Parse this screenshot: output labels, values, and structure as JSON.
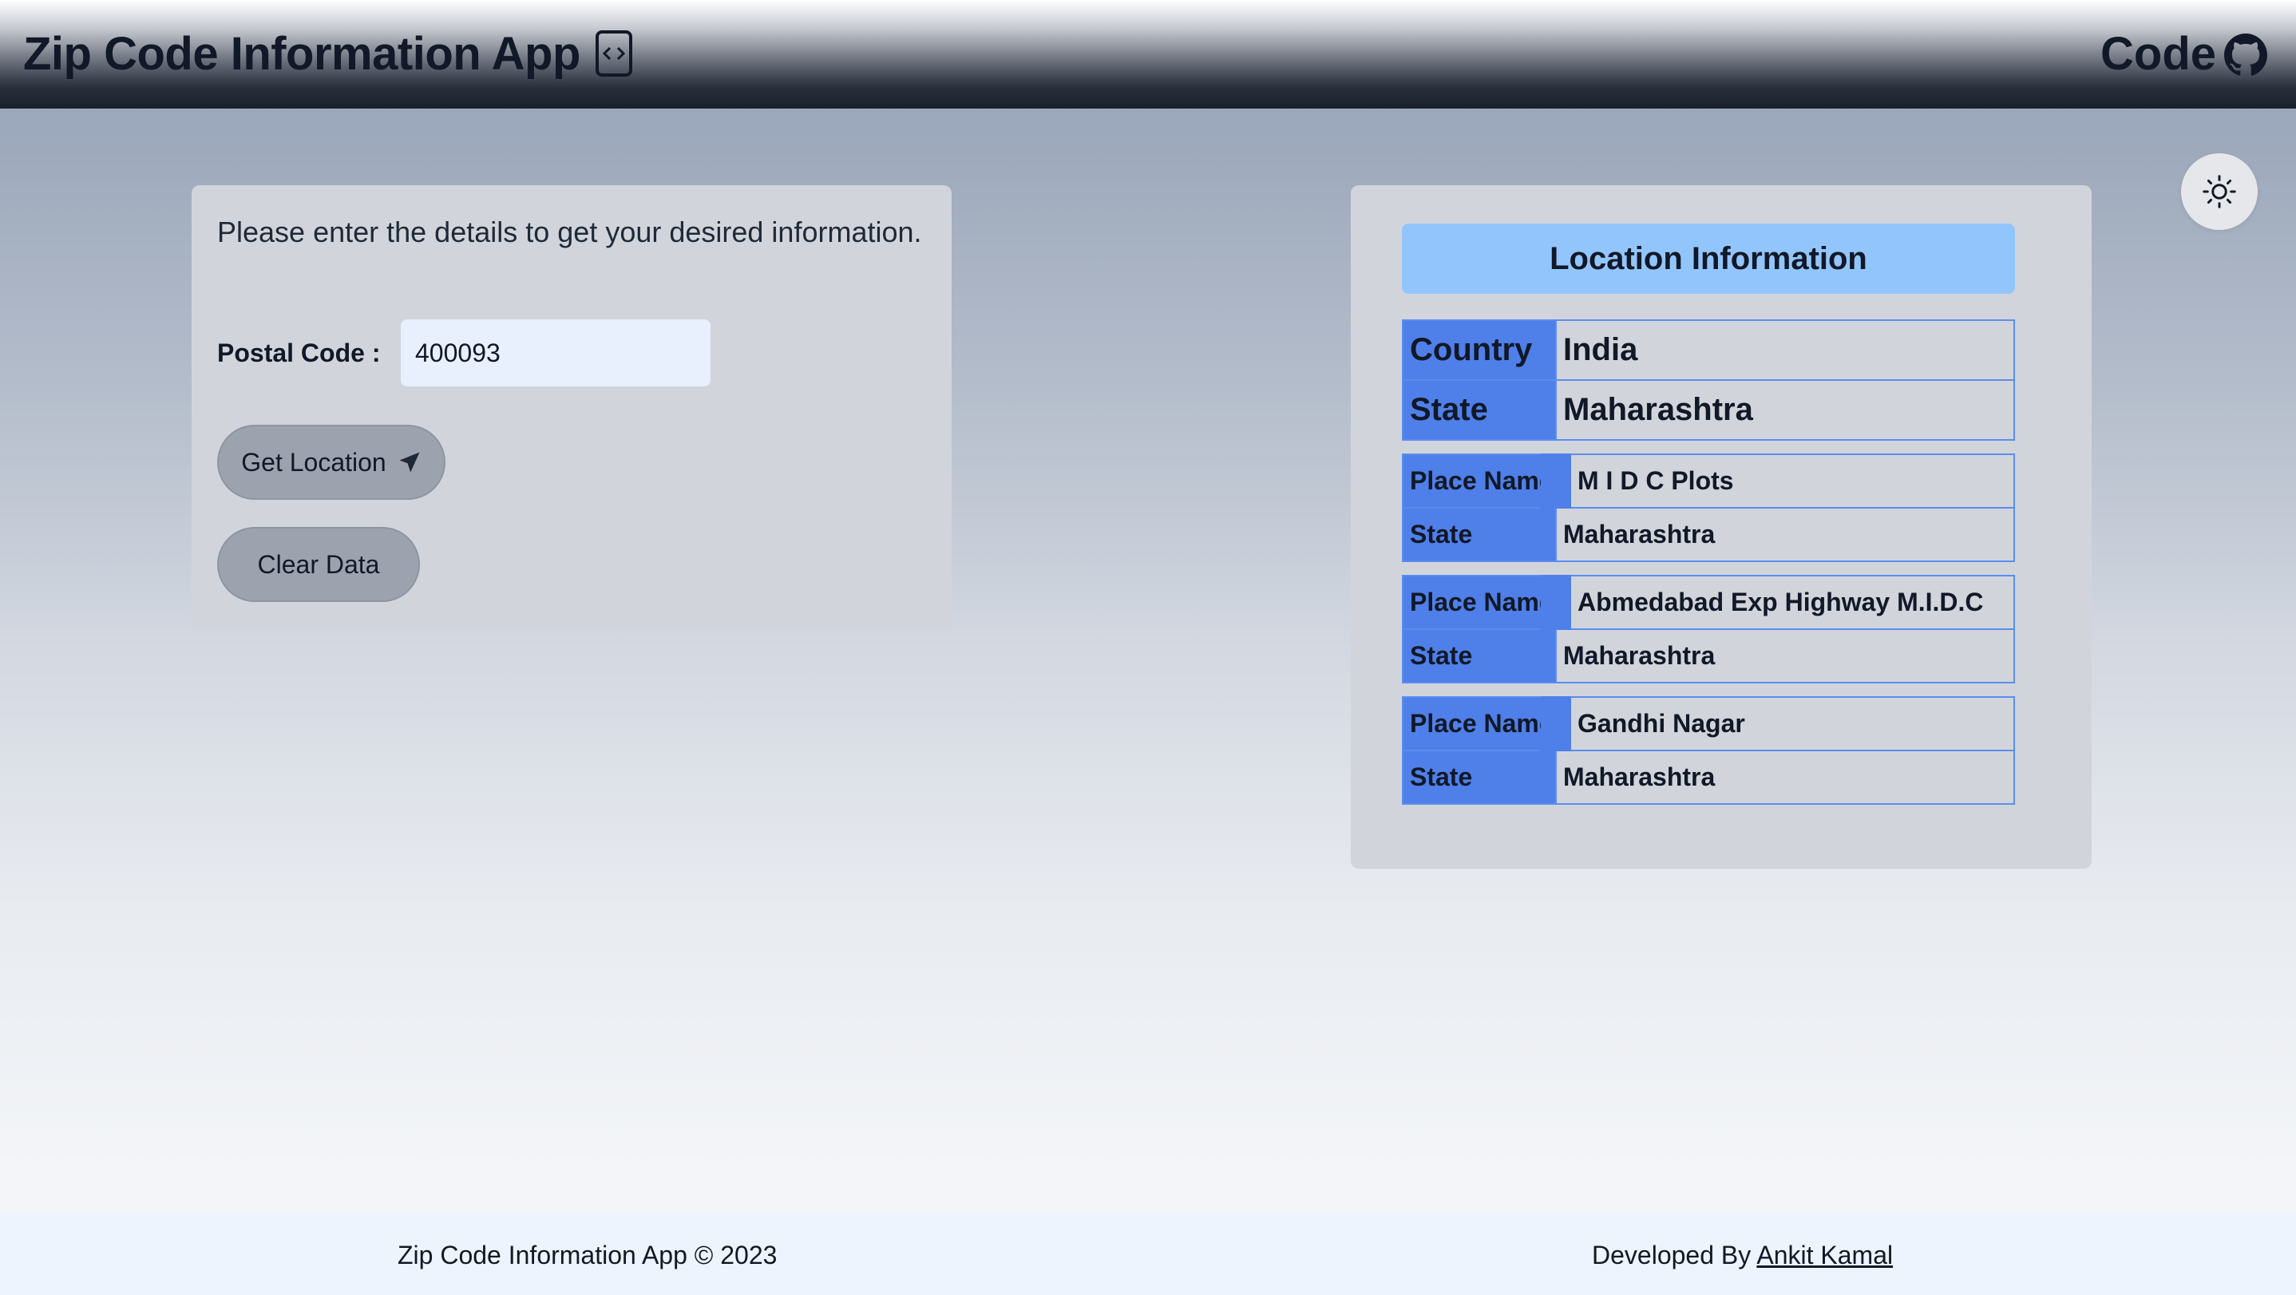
{
  "header": {
    "title": "Zip Code Information App",
    "code_label": "Code",
    "title_icon": "code-file-icon",
    "repo_icon": "github-icon"
  },
  "theme_toggle": {
    "icon": "sun-icon"
  },
  "form": {
    "intro": "Please enter the details to get your desired information.",
    "postal_label": "Postal Code :",
    "postal_value": "400093",
    "get_location_label": "Get Location",
    "get_location_icon": "paper-plane-icon",
    "clear_label": "Clear Data"
  },
  "location": {
    "title": "Location Information",
    "country_key": "Country",
    "country_value": "India",
    "state_key": "State",
    "state_value": "Maharashtra",
    "places": [
      {
        "place_key": "Place Name",
        "place_value": "M I D C Plots",
        "state_key": "State",
        "state_value": "Maharashtra"
      },
      {
        "place_key": "Place Name",
        "place_value": "Abmedabad Exp Highway M.I.D.C",
        "state_key": "State",
        "state_value": "Maharashtra"
      },
      {
        "place_key": "Place Name",
        "place_value": "Gandhi Nagar",
        "state_key": "State",
        "state_value": "Maharashtra"
      }
    ]
  },
  "footer": {
    "left": "Zip Code Information App © 2023",
    "developed_by": "Developed By ",
    "author": "Ankit Kamal"
  },
  "colors": {
    "key_cell": "#4f7fe8",
    "info_header": "#93c5fd",
    "card": "#d1d5db",
    "button": "#9ca3af"
  }
}
